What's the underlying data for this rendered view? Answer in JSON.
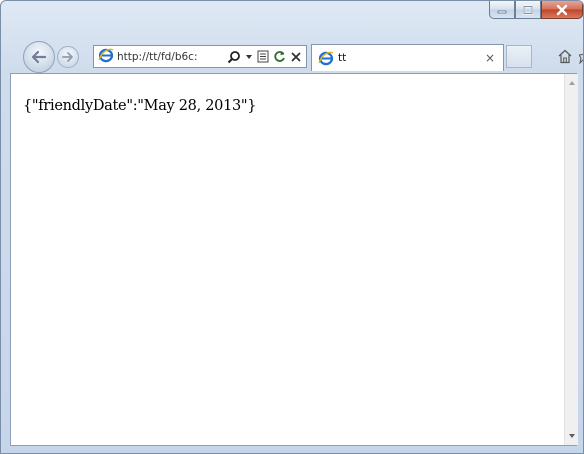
{
  "browser": {
    "address_url": "http://tt/fd/b6c:",
    "tab_title": "tt",
    "tab_close": "×"
  },
  "page": {
    "body_text": "{\"friendlyDate\":\"May 28, 2013\"}"
  },
  "colors": {
    "close_button": "#c0442a",
    "ie_logo": "#1f6fd0"
  },
  "icons": {
    "back": "back-arrow-icon",
    "forward": "forward-arrow-icon",
    "search": "search-icon",
    "compat": "compatibility-view-icon",
    "refresh": "refresh-icon",
    "stop": "stop-icon",
    "home": "home-icon",
    "favorites": "favorites-star-icon"
  }
}
